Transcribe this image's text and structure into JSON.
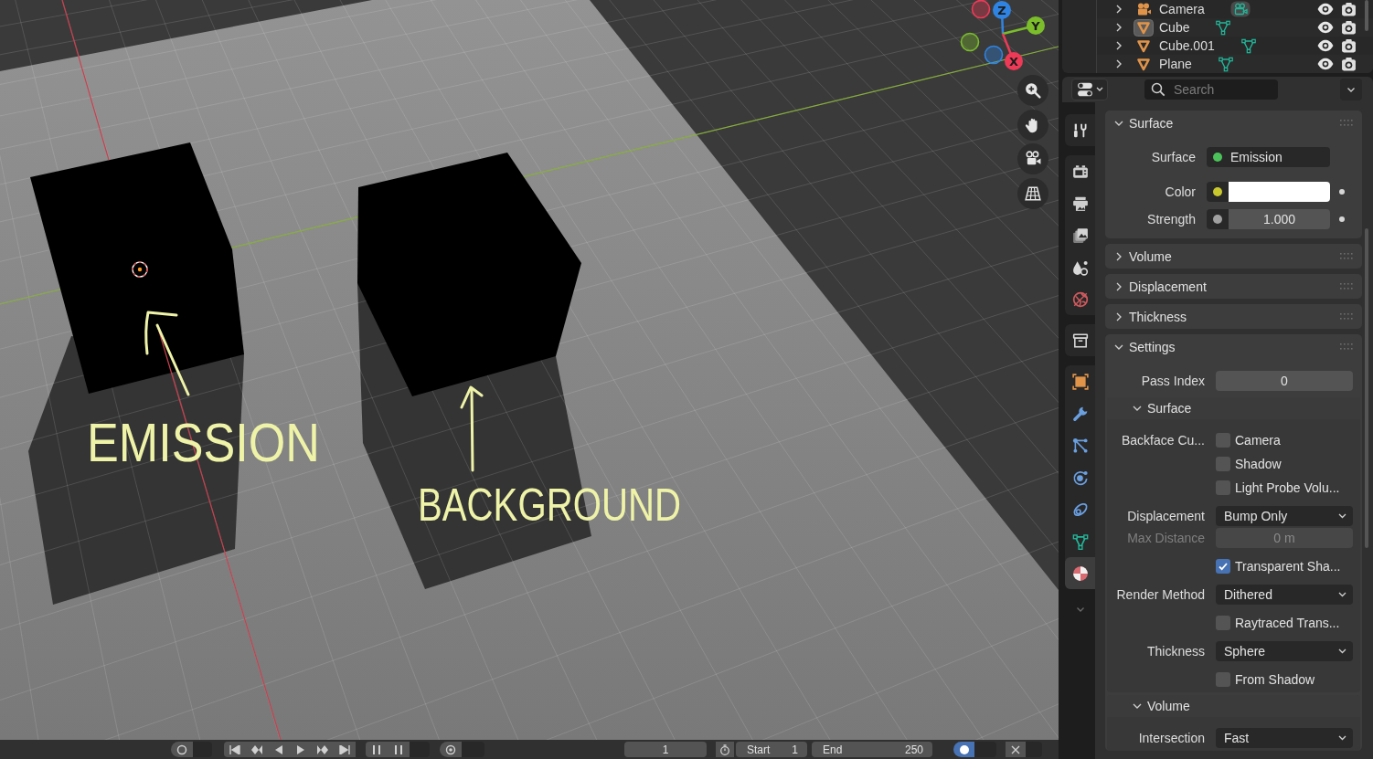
{
  "viewport": {
    "annotations": [
      {
        "text": "EMISSION"
      },
      {
        "text": "BACKGROUND"
      }
    ],
    "gizmo_axes": [
      {
        "label": "Z",
        "color": "#2f84e3"
      },
      {
        "label": "Y",
        "color": "#7bbd2a"
      },
      {
        "label": "X",
        "color": "#ee3a57"
      }
    ]
  },
  "timeline": {
    "frame": "1",
    "start": {
      "label": "Start",
      "value": "1"
    },
    "end": {
      "label": "End",
      "value": "250"
    },
    "toggle": {
      "on": true
    }
  },
  "outliner": {
    "rows": [
      {
        "kind": "camera",
        "name": "Camera",
        "active": false
      },
      {
        "kind": "mesh",
        "name": "Cube",
        "active": true
      },
      {
        "kind": "mesh",
        "name": "Cube.001",
        "active": false
      },
      {
        "kind": "mesh",
        "name": "Plane",
        "active": false
      }
    ]
  },
  "properties": {
    "search": {
      "placeholder": "Search"
    },
    "tab_groups": [
      {
        "tabs": [
          {
            "kind": "tool",
            "selected": false
          }
        ]
      },
      {
        "tabs": [
          {
            "kind": "render",
            "selected": false
          },
          {
            "kind": "output",
            "selected": false
          },
          {
            "kind": "view_layer",
            "selected": false
          },
          {
            "kind": "scene",
            "selected": false
          },
          {
            "kind": "world",
            "selected": false
          }
        ]
      },
      {
        "tabs": [
          {
            "kind": "collection",
            "selected": false
          }
        ]
      },
      {
        "tabs": [
          {
            "kind": "object",
            "selected": false
          },
          {
            "kind": "modifiers",
            "selected": false
          },
          {
            "kind": "particles",
            "selected": false
          },
          {
            "kind": "physics",
            "selected": false
          },
          {
            "kind": "constraints",
            "selected": false
          },
          {
            "kind": "data",
            "selected": false
          },
          {
            "kind": "material",
            "selected": true
          }
        ]
      }
    ],
    "panels": [
      {
        "title": "Surface",
        "expanded": true,
        "rows": [
          {
            "kind": "shader",
            "label": "Surface",
            "value": "Emission",
            "color": "#4cc35a"
          },
          {
            "kind": "color",
            "label": "Color",
            "color": "#c9c92e",
            "swatch": {
              "color": "#ffffff"
            }
          },
          {
            "kind": "value",
            "label": "Strength",
            "color": "#a0a0a0",
            "value": "1.000"
          }
        ]
      },
      {
        "title": "Volume",
        "expanded": false
      },
      {
        "title": "Displacement",
        "expanded": false
      },
      {
        "title": "Thickness",
        "expanded": false
      },
      {
        "title": "Settings",
        "expanded": true,
        "rows": [
          {
            "kind": "number",
            "label": "Pass Index",
            "value": "0",
            "disabled": false
          },
          {
            "kind": "subpanel",
            "title": "Surface",
            "expanded": true,
            "rows": [
              {
                "kind": "checkbox",
                "label": "Backface Cu...",
                "text": "Camera",
                "checked": false
              },
              {
                "kind": "checkbox",
                "text": "Shadow",
                "checked": false
              },
              {
                "kind": "checkbox",
                "text": "Light Probe Volu...",
                "checked": false
              },
              {
                "kind": "dropdown",
                "label": "Displacement",
                "value": "Bump Only"
              },
              {
                "kind": "number",
                "label": "Max Distance",
                "value": "0 m",
                "disabled": true
              },
              {
                "kind": "checkbox",
                "text": "Transparent Sha...",
                "checked": true
              },
              {
                "kind": "dropdown",
                "label": "Render Method",
                "value": "Dithered"
              },
              {
                "kind": "checkbox",
                "text": "Raytraced Trans...",
                "checked": false
              },
              {
                "kind": "dropdown",
                "label": "Thickness",
                "value": "Sphere"
              },
              {
                "kind": "checkbox",
                "text": "From Shadow",
                "checked": false
              }
            ]
          },
          {
            "kind": "subpanel",
            "title": "Volume",
            "expanded": true,
            "rows": [
              {
                "kind": "dropdown",
                "label": "Intersection",
                "value": "Fast"
              }
            ]
          }
        ]
      }
    ]
  }
}
